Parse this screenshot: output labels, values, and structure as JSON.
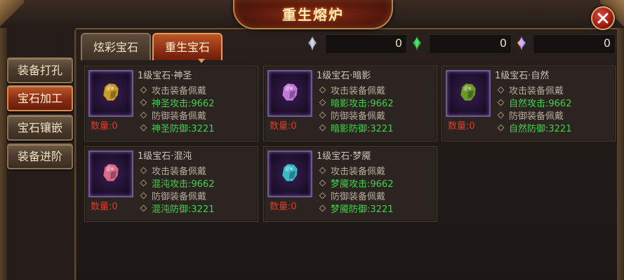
{
  "window": {
    "title": "重生熔炉"
  },
  "sidebar": {
    "items": [
      {
        "label": "装备打孔"
      },
      {
        "label": "宝石加工"
      },
      {
        "label": "宝石镶嵌"
      },
      {
        "label": "装备进阶"
      }
    ],
    "active_index": 1
  },
  "tabs": [
    {
      "label": "炫彩宝石"
    },
    {
      "label": "重生宝石"
    }
  ],
  "active_tab": 1,
  "counters": [
    {
      "icon": "silver-crystal-icon",
      "value": "0"
    },
    {
      "icon": "green-crystal-icon",
      "value": "0"
    },
    {
      "icon": "rainbow-crystal-icon",
      "value": "0"
    }
  ],
  "colors": {
    "active_red": "#8a2c12",
    "green_text": "#3fd24a",
    "qty_red": "#e23a2a"
  },
  "gems": [
    {
      "name": "1级宝石·神圣",
      "equip1": "攻击装备佩戴",
      "stat1": "神圣攻击:9662",
      "equip2": "防御装备佩戴",
      "stat2": "神圣防御:3221",
      "qty": "数量:0",
      "color": "#c89a2a"
    },
    {
      "name": "1级宝石·暗影",
      "equip1": "攻击装备佩戴",
      "stat1": "暗影攻击:9662",
      "equip2": "防御装备佩戴",
      "stat2": "暗影防御:3221",
      "qty": "数量:0",
      "color": "#c27ad8"
    },
    {
      "name": "1级宝石·自然",
      "equip1": "攻击装备佩戴",
      "stat1": "自然攻击:9662",
      "equip2": "防御装备佩戴",
      "stat2": "自然防御:3221",
      "qty": "数量:0",
      "color": "#6a9a2a"
    },
    {
      "name": "1级宝石·混沌",
      "equip1": "攻击装备佩戴",
      "stat1": "混沌攻击:9662",
      "equip2": "防御装备佩戴",
      "stat2": "混沌防御:3221",
      "qty": "数量:0",
      "color": "#d86a8a"
    },
    {
      "name": "1级宝石·梦魇",
      "equip1": "攻击装备佩戴",
      "stat1": "梦魇攻击:9662",
      "equip2": "防御装备佩戴",
      "stat2": "梦魇防御:3221",
      "qty": "数量:0",
      "color": "#3ab8c8"
    }
  ]
}
